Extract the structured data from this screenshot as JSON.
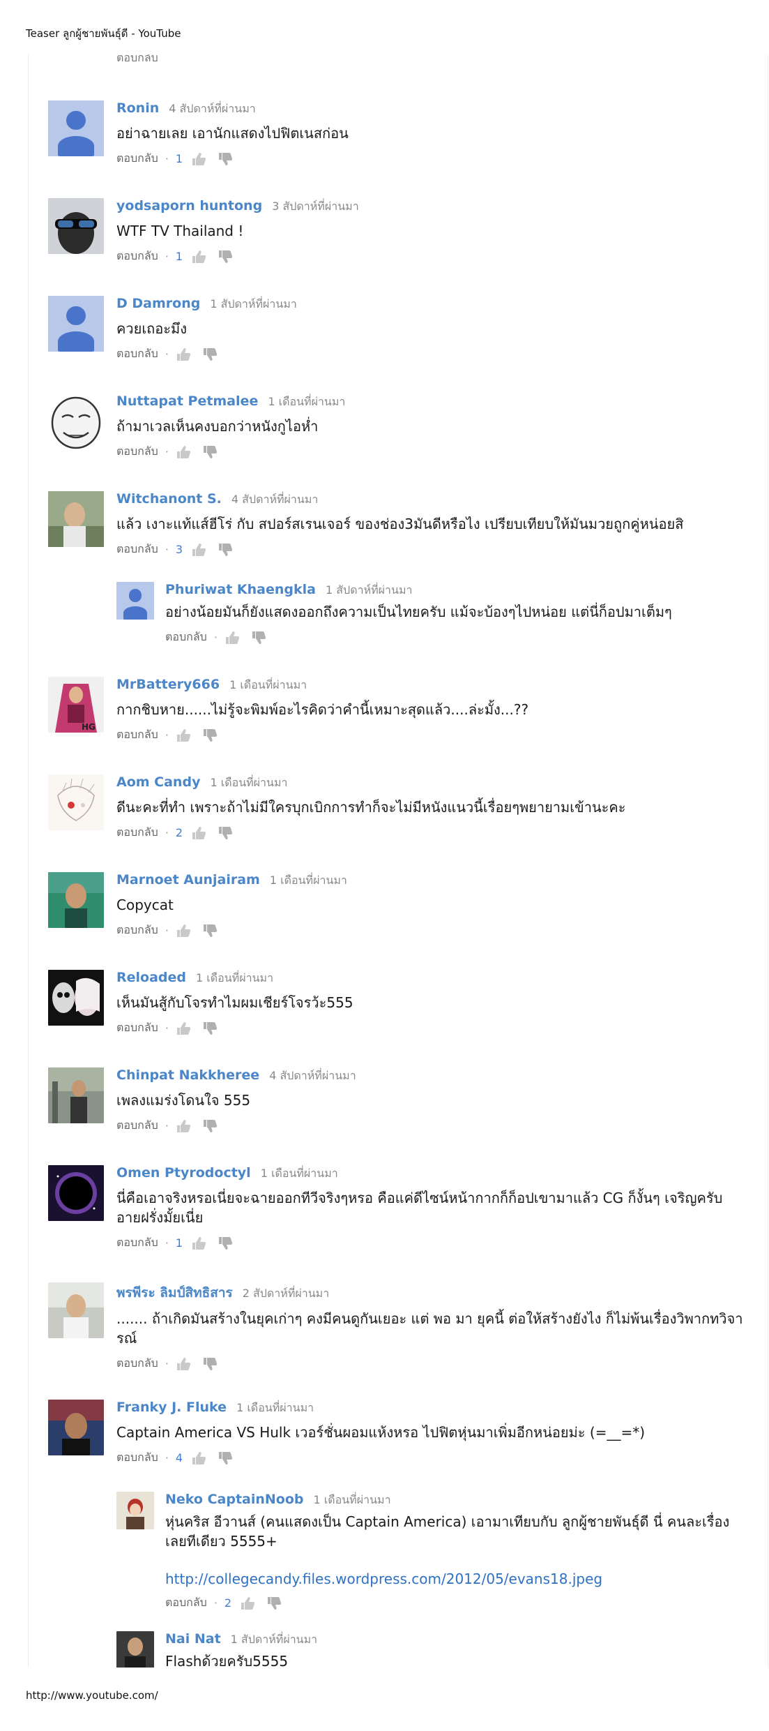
{
  "page": {
    "header_title": "Teaser ลูกผู้ชายพันธุ์ดี - YouTube",
    "footer_url": "http://www.youtube.com/"
  },
  "partial_row": {
    "reply_label": "ตอบกลับ"
  },
  "comments": [
    {
      "author": "Ronin",
      "time": "4 สัปดาห์ที่ผ่านมา",
      "text": "อย่าฉายเลย เอานักแสดงไปฟิตเนสก่อน",
      "reply_label": "ตอบกลับ",
      "likes": "1",
      "avatar": "default-avatar"
    },
    {
      "author": "yodsaporn huntong",
      "time": "3 สัปดาห์ที่ผ่านมา",
      "text": "WTF TV Thailand !",
      "reply_label": "ตอบกลับ",
      "likes": "1",
      "avatar": "photo-sunglasses"
    },
    {
      "author": "D Damrong",
      "time": "1 สัปดาห์ที่ผ่านมา",
      "text": "ควยเถอะมึง",
      "reply_label": "ตอบกลับ",
      "likes": "",
      "avatar": "default-avatar"
    },
    {
      "author": "Nuttapat Petmalee",
      "time": "1 เดือนที่ผ่านมา",
      "text": "ถ้ามาเวลเห็นคงบอกว่าหนังกูไอห่ำ",
      "reply_label": "ตอบกลับ",
      "likes": "",
      "avatar": "meme-face"
    },
    {
      "author": "Witchanont S.",
      "time": "4 สัปดาห์ที่ผ่านมา",
      "text": "แล้ว เงาะแท้แส์ฮีโร่ กับ สปอร์สเรนเจอร์ ของช่อง3มันดีหรือไง เปรียบเทียบให้มันมวยถูกคู่หน่อยสิ",
      "reply_label": "ตอบกลับ",
      "likes": "3",
      "avatar": "photo-person"
    },
    {
      "author": "Phuriwat Khaengkla",
      "time": "1 สัปดาห์ที่ผ่านมา",
      "text": "อย่างน้อยมันก็ยังแสดงออกถึงความเป็นไทยครับ แม้จะบ้องๆไปหน่อย แต่นี่ก็อปมาเต็มๆ",
      "reply_label": "ตอบกลับ",
      "likes": "",
      "avatar": "default-avatar",
      "is_reply": true
    },
    {
      "author": "MrBattery666",
      "time": "1 เดือนที่ผ่านมา",
      "text": "กากชิบหาย......ไม่รู้จะพิมพ์อะไรคิดว่าคำนี้เหมาะสุดแล้ว....ล่ะมั้ง...??",
      "reply_label": "ตอบกลับ",
      "likes": "",
      "avatar": "photo-fighter"
    },
    {
      "author": "Aom Candy",
      "time": "1 เดือนที่ผ่านมา",
      "text": "ดีนะคะที่ทำ เพราะถ้าไม่มีใครบุกเบิกการทำก็จะไม่มีหนังแนวนี้เรื่อยๆพยายามเข้านะคะ",
      "reply_label": "ตอบกลับ",
      "likes": "2",
      "avatar": "anime-sketch"
    },
    {
      "author": "Marnoet Aunjairam",
      "time": "1 เดือนที่ผ่านมา",
      "text": "Copycat",
      "reply_label": "ตอบกลับ",
      "likes": "",
      "avatar": "photo-person"
    },
    {
      "author": "Reloaded",
      "time": "1 เดือนที่ผ่านมา",
      "text": "เห็นมันสู้กับโจรทำไมผมเชียร์โจรว้ะ555",
      "reply_label": "ตอบกลับ",
      "likes": "",
      "avatar": "skull-mask"
    },
    {
      "author": "Chinpat Nakkheree",
      "time": "4 สัปดาห์ที่ผ่านมา",
      "text": "เพลงแมร่งโดนใจ 555",
      "reply_label": "ตอบกลับ",
      "likes": "",
      "avatar": "photo-street"
    },
    {
      "author": "Omen Ptyrodoctyl",
      "time": "1 เดือนที่ผ่านมา",
      "text": "นี่คือเอาจริงหรอเนี่ยจะฉายออกทีวีจริงๆหรอ คือแค่ดีไซน์หน้ากากก็ก็อปเขามาแล้ว CG ก็งั้นๆ เจริญครับอายฝรั่งมั้ยเนี่ย",
      "reply_label": "ตอบกลับ",
      "likes": "1",
      "avatar": "eclipse"
    },
    {
      "author": "พรพีระ ลิมป์สิทธิสาร",
      "time": "2 สัปดาห์ที่ผ่านมา",
      "text": "....... ถ้าเกิดมันสร้างในยุคเก่าๆ คงมีคนดูกันเยอะ แต่ พอ มา ยุคนี้ ต่อให้สร้างยังไง ก็ไม่พ้นเรื่องวิพากทวิจารณ์",
      "reply_label": "ตอบกลับ",
      "likes": "",
      "avatar": "photo-person"
    },
    {
      "author": "Franky J. Fluke",
      "time": "1 เดือนที่ผ่านมา",
      "text": "Captain America VS Hulk เวอร์ชั่นผอมแห้งหรอ ไปฟิตหุ่นมาเพิ่มอีกหน่อยม่ะ (=__=*)",
      "reply_label": "ตอบกลับ",
      "likes": "4",
      "avatar": "photo-person"
    },
    {
      "author": "Neko CaptainNoob",
      "time": "1 เดือนที่ผ่านมา",
      "text": "หุ่นคริส อีวานส์ (คนแสดงเป็น Captain America) เอามาเทียบกับ ลูกผู้ชายพันธุ์ดี นี่ คนละเรื่องเลยทีเดียว 5555+",
      "link": "http://collegecandy.files.wordpress.com/2012/05/evans18.jpeg",
      "reply_label": "ตอบกลับ",
      "likes": "2",
      "avatar": "photo-anime",
      "is_reply": true
    },
    {
      "author": "Nai Nat",
      "time": "1 สัปดาห์ที่ผ่านมา",
      "text": "Flashด้วยครับ5555",
      "reply_label": "",
      "likes": "",
      "avatar": "photo-person",
      "is_reply": true
    }
  ]
}
